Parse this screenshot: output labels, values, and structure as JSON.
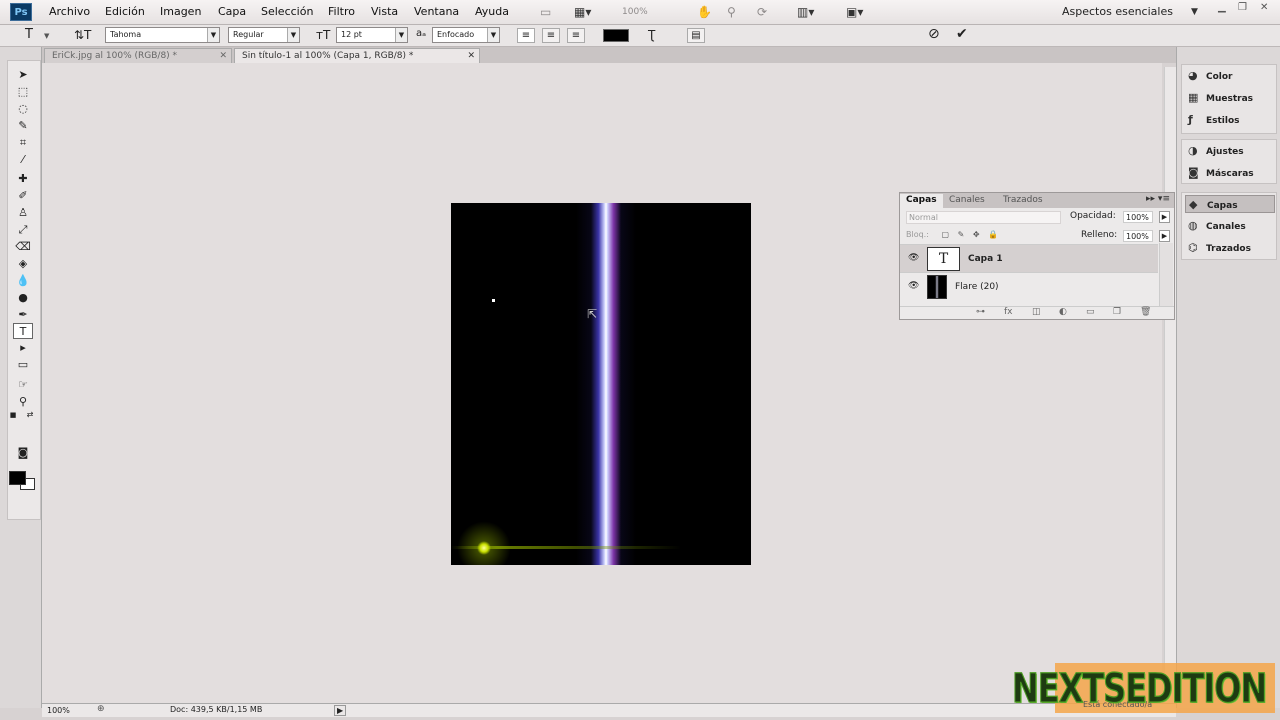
{
  "app": {
    "logo": "Ps"
  },
  "menubar": {
    "items": [
      "Archivo",
      "Edición",
      "Imagen",
      "Capa",
      "Selección",
      "Filtro",
      "Vista",
      "Ventana",
      "Ayuda"
    ],
    "zoom": "100%",
    "workspace": "Aspectos esenciales"
  },
  "options": {
    "tool_glyph": "T",
    "font_family": "Tahoma",
    "font_style": "Regular",
    "font_size": "12 pt",
    "antialias_prefix": "a",
    "antialias": "Enfocado",
    "text_color": "#000000"
  },
  "tabs": [
    {
      "label": "EriCk.jpg al 100% (RGB/8) *"
    },
    {
      "label": "Sin título-1 al 100% (Capa 1, RGB/8) *"
    }
  ],
  "layers_panel": {
    "tabs": [
      "Capas",
      "Canales",
      "Trazados"
    ],
    "blend_mode": "Normal",
    "opacity_label": "Opacidad:",
    "opacity_value": "100%",
    "lock_label": "Bloq.:",
    "fill_label": "Relleno:",
    "fill_value": "100%",
    "layers": [
      {
        "name": "Capa 1",
        "thumb": "T",
        "visible": true,
        "selected": true
      },
      {
        "name": "Flare (20)",
        "thumb": "",
        "visible": true,
        "selected": false
      }
    ]
  },
  "right_dock": {
    "group1": [
      {
        "label": "Color",
        "icon": "color-icon"
      },
      {
        "label": "Muestras",
        "icon": "swatches-icon"
      },
      {
        "label": "Estilos",
        "icon": "styles-icon"
      }
    ],
    "group2": [
      {
        "label": "Ajustes",
        "icon": "adjustments-icon"
      },
      {
        "label": "Máscaras",
        "icon": "masks-icon"
      }
    ],
    "group3": [
      {
        "label": "Capas",
        "icon": "layers-icon"
      },
      {
        "label": "Canales",
        "icon": "channels-icon"
      },
      {
        "label": "Trazados",
        "icon": "paths-icon"
      }
    ]
  },
  "status": {
    "zoom": "100%",
    "doc": "Doc: 439,5 KB/1,15 MB"
  },
  "watermark": {
    "text": "NEXTSEDITION",
    "sub": "Está conectado/a"
  }
}
